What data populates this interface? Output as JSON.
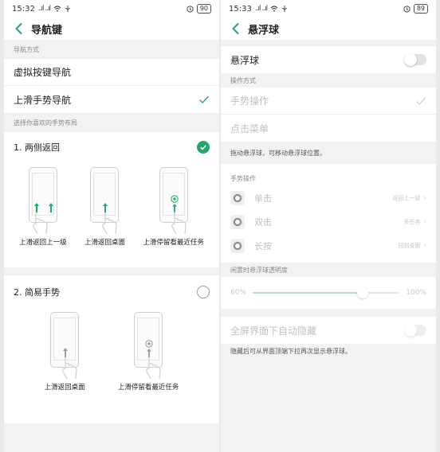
{
  "left": {
    "status": {
      "time": "15:32",
      "signal": "..ıl ..ıl",
      "battery": "90"
    },
    "title": "导航键",
    "section_nav_mode": "导航方式",
    "nav_options": [
      {
        "label": "虚拟按键导航",
        "selected": false
      },
      {
        "label": "上滑手势导航",
        "selected": true
      }
    ],
    "section_layout": "选择你喜欢的手势布局",
    "layout_option_1": {
      "title": "1. 两侧返回",
      "selected": true,
      "captions": [
        "上滑返回上一级",
        "上滑返回桌面",
        "上滑停留看最近任务"
      ]
    },
    "layout_option_2": {
      "title": "2. 简易手势",
      "selected": false,
      "captions": [
        "上滑返回桌面",
        "上滑停留看最近任务"
      ]
    }
  },
  "right": {
    "status": {
      "time": "15:33",
      "signal": "..ıl ..ıl",
      "battery": "89"
    },
    "title": "悬浮球",
    "floating_ball_label": "悬浮球",
    "floating_ball_on": false,
    "section_operation": "操作方式",
    "operation_options": [
      {
        "label": "手势操作",
        "selected": true
      },
      {
        "label": "点击菜单",
        "selected": false
      }
    ],
    "drag_note": "拖动悬浮球，可移动悬浮球位置。",
    "section_gesture": "手势操作",
    "gestures": [
      {
        "label": "单击",
        "value": "返回上一级"
      },
      {
        "label": "双击",
        "value": "多任务"
      },
      {
        "label": "长按",
        "value": "回到桌面"
      }
    ],
    "section_opacity": "闲置时悬浮球透明度",
    "opacity_min": "60%",
    "opacity_max": "100%",
    "opacity_level": 0.75,
    "auto_hide_label": "全屏界面下自动隐藏",
    "auto_hide_on": false,
    "hide_note": "隐藏后可从界面顶端下拉再次显示悬浮球。"
  },
  "colors": {
    "accent_green": "#26a66a",
    "section_bg": "#f2f2f2",
    "disabled_text": "#c0c0c0"
  },
  "icons": [
    "back-arrow-icon",
    "checkmark-icon",
    "green-check-icon",
    "radio-empty-icon",
    "up-arrow-icon",
    "hand-icon",
    "floating-ball-icon",
    "chevron-right-icon"
  ]
}
